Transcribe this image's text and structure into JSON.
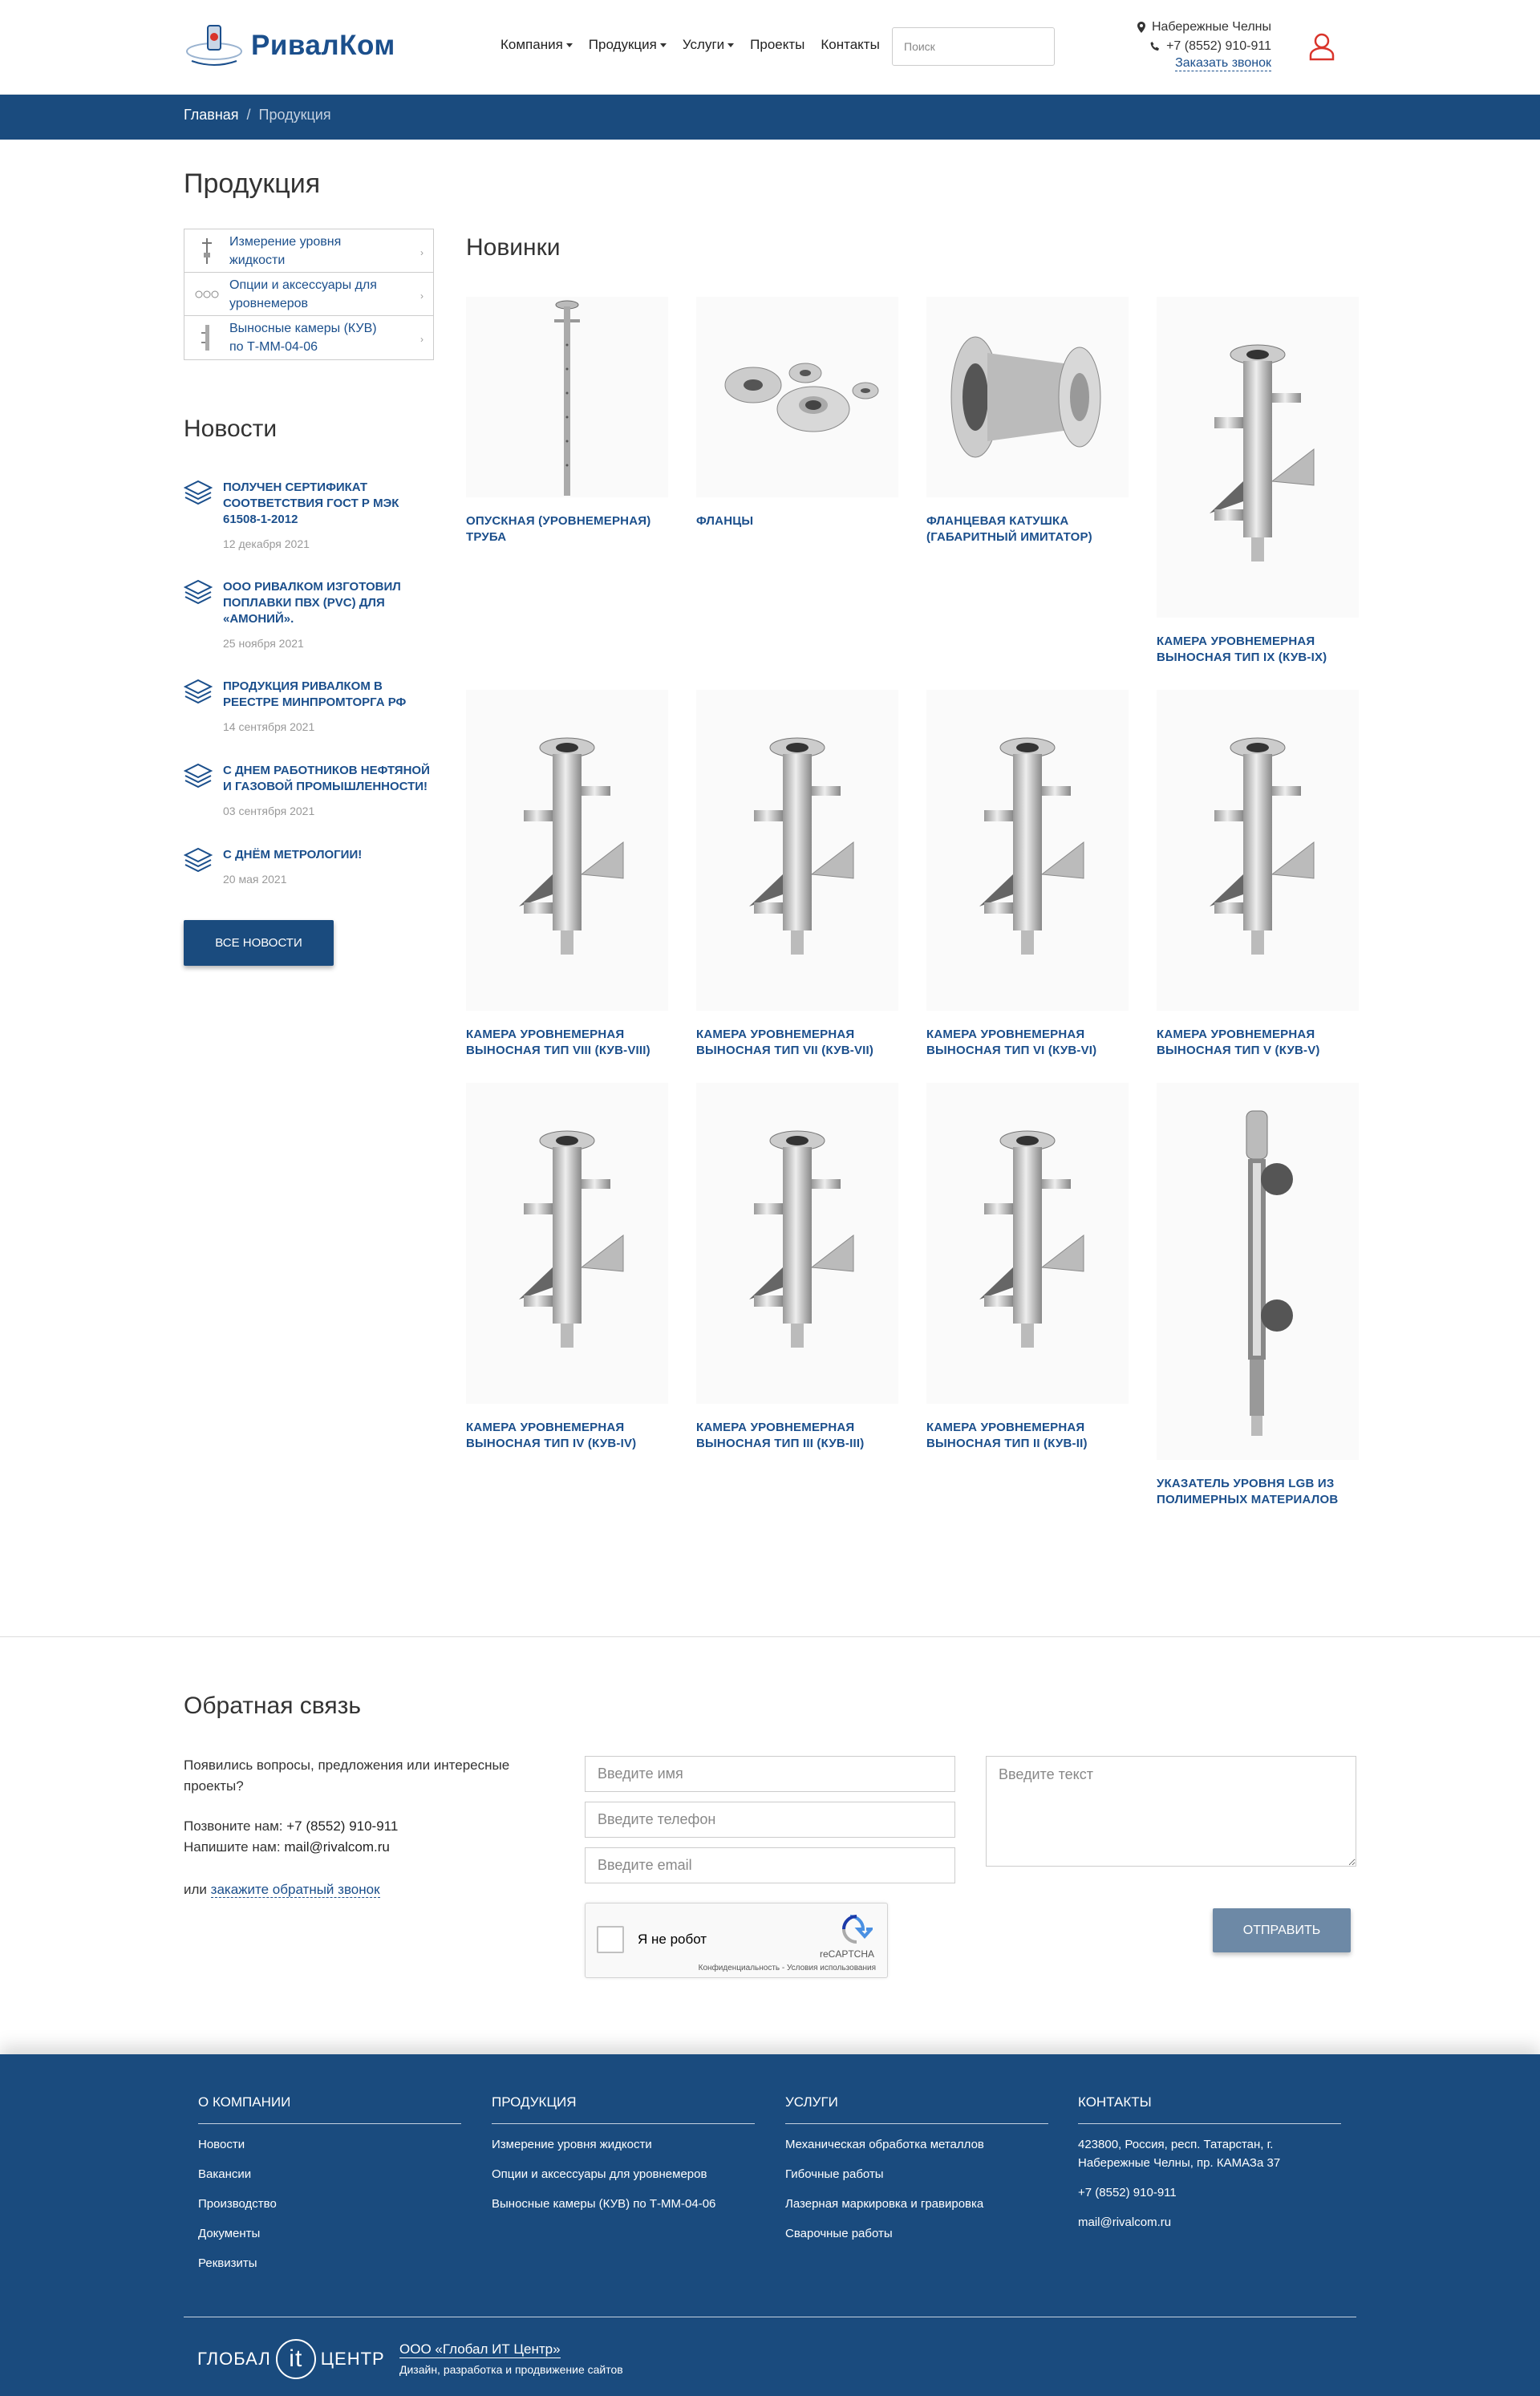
{
  "header": {
    "logo_text": "РивалКом",
    "nav": [
      {
        "label": "Компания",
        "dropdown": true
      },
      {
        "label": "Продукция",
        "dropdown": true
      },
      {
        "label": "Услуги",
        "dropdown": true
      },
      {
        "label": "Проекты",
        "dropdown": false
      },
      {
        "label": "Контакты",
        "dropdown": false
      }
    ],
    "search_placeholder": "Поиск",
    "city": "Набережные Челны",
    "phone": "+7 (8552) 910-911",
    "callback_link": "Заказать звонок"
  },
  "breadcrumb": {
    "home": "Главная",
    "separator": "/",
    "current": "Продукция"
  },
  "page_title": "Продукция",
  "categories": [
    {
      "label": "Измерение уровня жидкости"
    },
    {
      "label": "Опции и аксессуары для уровнемеров"
    },
    {
      "label": "Выносные камеры (КУВ) по Т-ММ-04-06"
    }
  ],
  "news": {
    "title": "Новости",
    "items": [
      {
        "title": "ПОЛУЧЕН СЕРТИФИКАТ СООТВЕТСТВИЯ ГОСТ Р МЭК 61508-1-2012",
        "date": "12 декабря 2021"
      },
      {
        "title": "ООО РИВАЛКОМ ИЗГОТОВИЛ ПОПЛАВКИ ПВХ (PVC) ДЛЯ «АМОНИЙ».",
        "date": "25 ноября 2021"
      },
      {
        "title": "ПРОДУКЦИЯ РИВАЛКОМ В РЕЕСТРЕ МИНПРОМТОРГА РФ",
        "date": "14 сентября 2021"
      },
      {
        "title": "С ДНЕМ РАБОТНИКОВ НЕФТЯНОЙ И ГАЗОВОЙ ПРОМЫШЛЕННОСТИ!",
        "date": "03 сентября 2021"
      },
      {
        "title": "С ДНЁМ МЕТРОЛОГИИ!",
        "date": "20 мая 2021"
      }
    ],
    "all_button": "ВСЕ НОВОСТИ"
  },
  "new_products": {
    "title": "Новинки",
    "items": [
      {
        "name": "ОПУСКНАЯ (УРОВНЕМЕРНАЯ) ТРУБА",
        "image": "pipe"
      },
      {
        "name": "ФЛАНЦЫ",
        "image": "flanges"
      },
      {
        "name": "ФЛАНЦЕВАЯ КАТУШКА (ГАБАРИТНЫЙ ИМИТАТОР)",
        "image": "spool"
      },
      {
        "name": "КАМЕРА УРОВНЕМЕРНАЯ ВЫНОСНАЯ ТИП IX (КУВ-IX)",
        "image": "chamber"
      },
      {
        "name": "КАМЕРА УРОВНЕМЕРНАЯ ВЫНОСНАЯ ТИП VIII (КУВ-VIII)",
        "image": "chamber"
      },
      {
        "name": "КАМЕРА УРОВНЕМЕРНАЯ ВЫНОСНАЯ ТИП VII (КУВ-VII)",
        "image": "chamber"
      },
      {
        "name": "КАМЕРА УРОВНЕМЕРНАЯ ВЫНОСНАЯ ТИП VI (КУВ-VI)",
        "image": "chamber"
      },
      {
        "name": "КАМЕРА УРОВНЕМЕРНАЯ ВЫНОСНАЯ ТИП V (КУВ-V)",
        "image": "chamber"
      },
      {
        "name": "КАМЕРА УРОВНЕМЕРНАЯ ВЫНОСНАЯ ТИП IV (КУВ-IV)",
        "image": "chamber"
      },
      {
        "name": "КАМЕРА УРОВНЕМЕРНАЯ ВЫНОСНАЯ ТИП III (КУВ-III)",
        "image": "chamber"
      },
      {
        "name": "КАМЕРА УРОВНЕМЕРНАЯ ВЫНОСНАЯ ТИП II (КУВ-II)",
        "image": "chamber"
      },
      {
        "name": "УКАЗАТЕЛЬ УРОВНЯ LGB ИЗ ПОЛИМЕРНЫХ МАТЕРИАЛОВ",
        "image": "gauge"
      }
    ]
  },
  "feedback": {
    "title": "Обратная связь",
    "intro": "Появились вопросы, предложения или интересные проекты?",
    "call_label": "Позвоните нам:",
    "call_value": "+7 (8552) 910-911",
    "mail_label": "Напишите нам:",
    "mail_value": "mail@rivalcom.ru",
    "or_text": "или",
    "callback_link": "закажите обратный звонок",
    "name_placeholder": "Введите имя",
    "phone_placeholder": "Введите телефон",
    "email_placeholder": "Введите email",
    "text_placeholder": "Введите текст",
    "captcha_label": "Я не робот",
    "captcha_brand": "reCAPTCHA",
    "captcha_terms": "Конфиденциальность - Условия использования",
    "send_button": "ОТПРАВИТЬ"
  },
  "footer": {
    "columns": [
      {
        "title": "О КОМПАНИИ",
        "items": [
          "Новости",
          "Вакансии",
          "Производство",
          "Документы",
          "Реквизиты"
        ]
      },
      {
        "title": "ПРОДУКЦИЯ",
        "items": [
          "Измерение уровня жидкости",
          "Опции и аксессуары для уровнемеров",
          "Выносные камеры (КУВ) по Т-ММ-04-06"
        ]
      },
      {
        "title": "УСЛУГИ",
        "items": [
          "Механическая обработка металлов",
          "Гибочные работы",
          "Лазерная маркировка и гравировка",
          "Сварочные работы"
        ]
      },
      {
        "title": "КОНТАКТЫ",
        "items": [
          "423800, Россия, респ. Татарстан, г. Набережные Челны, пр. КАМАЗа 37",
          "+7 (8552) 910-911",
          "mail@rivalcom.ru"
        ]
      }
    ],
    "dev_logo_left": "ГЛОБАЛ",
    "dev_logo_mid": "it",
    "dev_logo_right": "ЦЕНТР",
    "dev_name": "ООО «Глобал ИТ Центр»",
    "dev_desc": "Дизайн, разработка и продвижение сайтов"
  },
  "colors": {
    "brand": "#1a4b7e",
    "link": "#1b4f8c",
    "accent_user_icon": "#d9342b"
  }
}
